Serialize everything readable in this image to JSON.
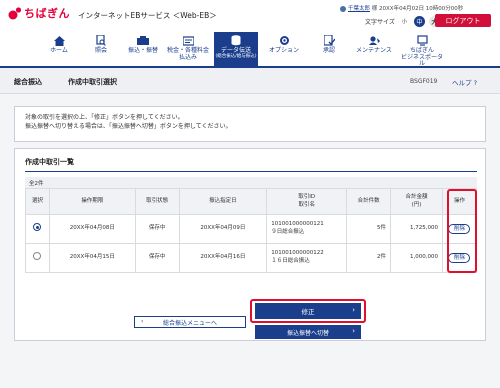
{
  "header": {
    "brand": "ちばぎん",
    "service": "インターネットEBサービス ＜Web-EB＞",
    "user_name": "千葉太郎",
    "user_suffix": "様",
    "last_login": "20XX年04月02日 10時00分00秒",
    "font_size_label": "文字サイズ",
    "font_small": "小",
    "font_mid": "中",
    "font_big": "大",
    "logout": "ログアウト"
  },
  "nav": [
    {
      "label": "ホーム",
      "icon": "home-icon"
    },
    {
      "label": "照会",
      "icon": "search-doc-icon"
    },
    {
      "label": "振込・振替",
      "icon": "transfer-icon"
    },
    {
      "label": "税金・各種料金",
      "sub": "払込み",
      "icon": "tax-icon"
    },
    {
      "label": "データ伝送",
      "sub": "(総合振込/給与振込)",
      "icon": "data-icon",
      "active": true
    },
    {
      "label": "オプション",
      "icon": "option-icon"
    },
    {
      "label": "承認",
      "icon": "approve-icon"
    },
    {
      "label": "メンテナンス",
      "icon": "maintenance-icon"
    },
    {
      "label": "ちばぎん",
      "sub": "ビジネスポータル",
      "icon": "portal-icon"
    }
  ],
  "titlebar": {
    "main": "総合振込",
    "sub": "作成中取引選択",
    "code": "BSGF019",
    "help": "ヘルプ"
  },
  "message": {
    "line1": "対象の取引を選択の上、「修正」ボタンを押してください。",
    "line2": "振込振替へ切り替える場合は、「振込振替へ切替」ボタンを押してください。"
  },
  "panel": {
    "title": "作成中取引一覧",
    "count": "全2件",
    "columns": [
      "選択",
      "操作期限",
      "取引状態",
      "振込指定日",
      "取引ID\n取引名",
      "合計件数",
      "合計金額\n(円)",
      "操作"
    ],
    "rows": [
      {
        "selected": true,
        "deadline": "20XX年04月08日",
        "status": "保存中",
        "date": "20XX年04月09日",
        "id": "101001000000121",
        "name": "９日総合振込",
        "count": "5件",
        "amount": "1,725,000",
        "action": "削除"
      },
      {
        "selected": false,
        "deadline": "20XX年04月15日",
        "status": "保存中",
        "date": "20XX年04月16日",
        "id": "101001000000122",
        "name": "１６日総合振込",
        "count": "2件",
        "amount": "1,000,000",
        "action": "削除"
      }
    ]
  },
  "buttons": {
    "back": "総合振込メニューへ",
    "edit": "修正",
    "switch": "振込振替へ切替"
  },
  "colors": {
    "brand_red": "#e4003a",
    "navy": "#1a3e8c",
    "highlight": "#e0102d"
  }
}
